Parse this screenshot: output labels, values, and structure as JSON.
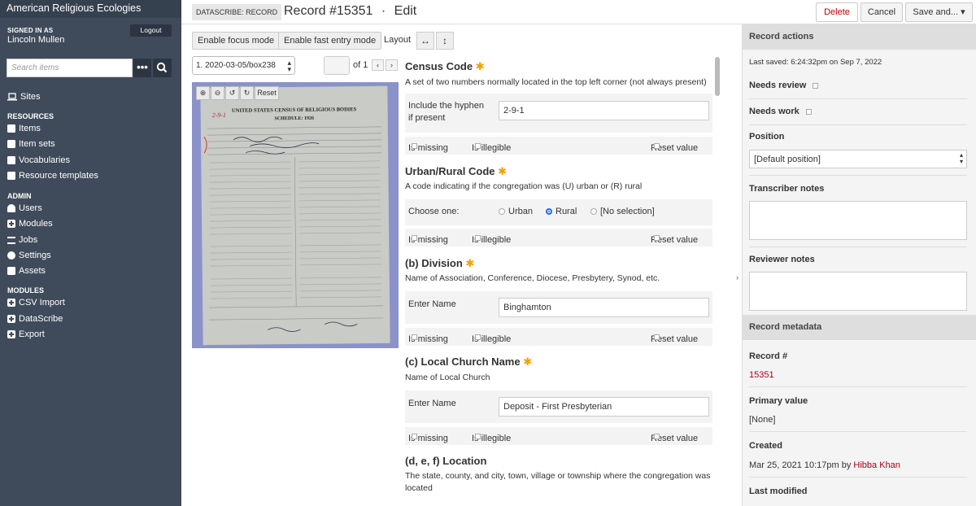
{
  "sidebar": {
    "site_title": "American Religious Ecologies",
    "signed_in_label": "SIGNED IN AS",
    "user_name": "Lincoln Mullen",
    "logout": "Logout",
    "search_placeholder": "Search items",
    "search_more": "•••",
    "sites": "Sites",
    "resources_head": "RESOURCES",
    "items": "Items",
    "item_sets": "Item sets",
    "vocabularies": "Vocabularies",
    "resource_templates": "Resource templates",
    "admin_head": "ADMIN",
    "users": "Users",
    "modules": "Modules",
    "jobs": "Jobs",
    "settings": "Settings",
    "assets": "Assets",
    "modules_head": "MODULES",
    "csv_import": "CSV Import",
    "datascribe": "DataScribe",
    "export": "Export"
  },
  "header": {
    "badge": "DATASCRIBE: RECORD",
    "title": "Record #15351",
    "separator": "·",
    "mode": "Edit",
    "delete": "Delete",
    "cancel": "Cancel",
    "save": "Save and... ▾"
  },
  "toolbar": {
    "focus_mode": "Enable focus mode",
    "fast_entry": "Enable fast entry mode",
    "layout": "Layout",
    "layout_horizontal": "↔",
    "layout_vertical": "↕"
  },
  "viewer": {
    "image_select": "1. 2020-03-05/box238",
    "page_of": "of 1",
    "prev": "‹",
    "next": "›",
    "reset": "Reset",
    "doc_heading": "UNITED STATES CENSUS OF RELIGIOUS BODIES",
    "doc_schedule": "SCHEDULE: 1926",
    "doc_code": "2-9-1"
  },
  "fields": [
    {
      "title": "Census Code",
      "desc": "A set of two numbers normally located in the top left corner (not always present)",
      "label": "Include the hyphen if present",
      "value": "2-9-1"
    },
    {
      "title": "Urban/Rural Code",
      "desc": "A code indicating if the congregation was (U) urban or (R) rural",
      "label": "Choose one:",
      "options": [
        "Urban",
        "Rural",
        "[No selection]"
      ],
      "selected": "Rural"
    },
    {
      "title": "(b) Division",
      "desc": "Name of Association, Conference, Diocese, Presbytery, Synod, etc.",
      "label": "Enter Name",
      "value": "Binghamton"
    },
    {
      "title": "(c) Local Church Name",
      "desc": "Name of Local Church",
      "label": "Enter Name",
      "value": "Deposit - First Presbyterian"
    },
    {
      "title": "(d, e, f) Location",
      "desc": "The state, county, and city, town, village or township where the congregation was located"
    }
  ],
  "flags": {
    "missing": "Is missing",
    "illegible": "Is illegible",
    "reset": "Reset value"
  },
  "right_panel": {
    "actions_head": "Record actions",
    "last_saved": "Last saved: 6:24:32pm on Sep 7, 2022",
    "needs_review": "Needs review",
    "needs_work": "Needs work",
    "position_label": "Position",
    "position_value": "[Default position]",
    "transcriber_notes": "Transcriber notes",
    "reviewer_notes": "Reviewer notes",
    "metadata_head": "Record metadata",
    "record_num_label": "Record #",
    "record_num": "15351",
    "primary_value_label": "Primary value",
    "primary_value": "[None]",
    "created_label": "Created",
    "created_value": "Mar 25, 2021 10:17pm by",
    "created_by": "Hibba Khan",
    "last_modified_label": "Last modified"
  }
}
